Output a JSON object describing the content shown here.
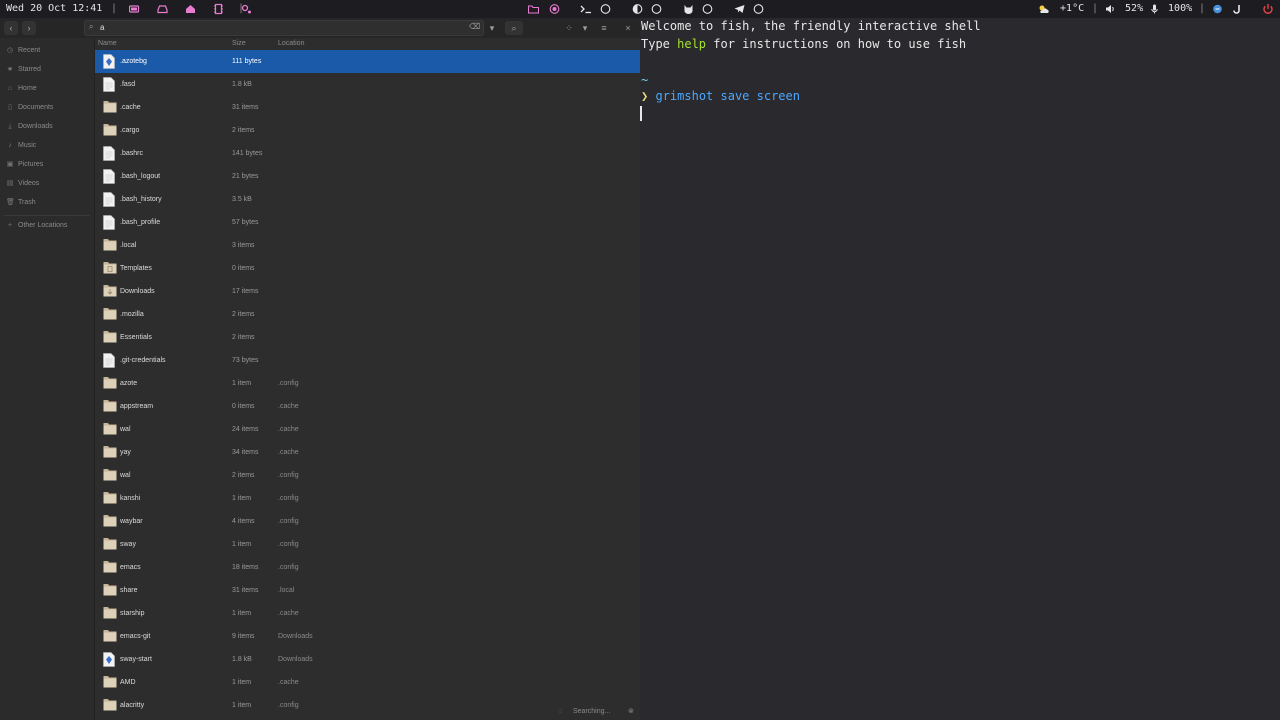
{
  "topbar": {
    "datetime": "Wed 20 Oct 12:41",
    "separator": "|",
    "weather": "+1°C",
    "volume": "52%",
    "mic": "100%"
  },
  "filemanager": {
    "search_value": "a",
    "columns": {
      "name": "Name",
      "size": "Size",
      "location": "Location"
    },
    "sidebar": [
      {
        "label": "Recent",
        "icon": "clock-icon"
      },
      {
        "label": "Starred",
        "icon": "star-icon"
      },
      {
        "label": "Home",
        "icon": "home-icon"
      },
      {
        "label": "Documents",
        "icon": "document-icon"
      },
      {
        "label": "Downloads",
        "icon": "download-icon"
      },
      {
        "label": "Music",
        "icon": "music-icon"
      },
      {
        "label": "Pictures",
        "icon": "picture-icon"
      },
      {
        "label": "Videos",
        "icon": "video-icon"
      },
      {
        "label": "Trash",
        "icon": "trash-icon"
      },
      {
        "label": "Other Locations",
        "icon": "plus-icon"
      }
    ],
    "files": [
      {
        "name": ".azotebg",
        "size": "111 bytes",
        "location": "",
        "type": "script",
        "selected": true
      },
      {
        "name": ".fasd",
        "size": "1.8 kB",
        "location": "",
        "type": "file"
      },
      {
        "name": ".cache",
        "size": "31 items",
        "location": "",
        "type": "folder"
      },
      {
        "name": ".cargo",
        "size": "2 items",
        "location": "",
        "type": "folder"
      },
      {
        "name": ".bashrc",
        "size": "141 bytes",
        "location": "",
        "type": "file"
      },
      {
        "name": ".bash_logout",
        "size": "21 bytes",
        "location": "",
        "type": "file"
      },
      {
        "name": ".bash_history",
        "size": "3.5 kB",
        "location": "",
        "type": "file"
      },
      {
        "name": ".bash_profile",
        "size": "57 bytes",
        "location": "",
        "type": "file"
      },
      {
        "name": ".local",
        "size": "3 items",
        "location": "",
        "type": "folder"
      },
      {
        "name": "Templates",
        "size": "0 items",
        "location": "",
        "type": "folder-templates"
      },
      {
        "name": "Downloads",
        "size": "17 items",
        "location": "",
        "type": "folder-downloads"
      },
      {
        "name": ".mozilla",
        "size": "2 items",
        "location": "",
        "type": "folder"
      },
      {
        "name": "Essentials",
        "size": "2 items",
        "location": "",
        "type": "folder"
      },
      {
        "name": ".git-credentials",
        "size": "73 bytes",
        "location": "",
        "type": "file"
      },
      {
        "name": "azote",
        "size": "1 item",
        "location": ".config",
        "type": "folder"
      },
      {
        "name": "appstream",
        "size": "0 items",
        "location": ".cache",
        "type": "folder"
      },
      {
        "name": "wal",
        "size": "24 items",
        "location": ".cache",
        "type": "folder"
      },
      {
        "name": "yay",
        "size": "34 items",
        "location": ".cache",
        "type": "folder"
      },
      {
        "name": "wal",
        "size": "2 items",
        "location": ".config",
        "type": "folder"
      },
      {
        "name": "kanshi",
        "size": "1 item",
        "location": ".config",
        "type": "folder"
      },
      {
        "name": "waybar",
        "size": "4 items",
        "location": ".config",
        "type": "folder"
      },
      {
        "name": "sway",
        "size": "1 item",
        "location": ".config",
        "type": "folder"
      },
      {
        "name": "emacs",
        "size": "18 items",
        "location": ".config",
        "type": "folder"
      },
      {
        "name": "share",
        "size": "31 items",
        "location": ".local",
        "type": "folder"
      },
      {
        "name": "starship",
        "size": "1 item",
        "location": ".cache",
        "type": "folder"
      },
      {
        "name": "emacs-git",
        "size": "9 items",
        "location": "Downloads",
        "type": "folder"
      },
      {
        "name": "sway-start",
        "size": "1.8 kB",
        "location": "Downloads",
        "type": "script"
      },
      {
        "name": "AMD",
        "size": "1 item",
        "location": ".cache",
        "type": "folder"
      },
      {
        "name": "alacritty",
        "size": "1 item",
        "location": ".config",
        "type": "folder"
      }
    ],
    "status": "Searching..."
  },
  "terminal": {
    "welcome": "Welcome to fish, the friendly interactive shell",
    "help_pre": "Type ",
    "help_word": "help",
    "help_post": " for instructions on how to use fish",
    "cwd": "~",
    "prompt": "❯",
    "cmd": "grimshot",
    "args": "save screen"
  },
  "colors": {
    "selection": "#1b5aa8",
    "accent_pink": "#e77cd0",
    "prompt_green": "#a6e22e",
    "command_blue": "#4ba8ff"
  }
}
